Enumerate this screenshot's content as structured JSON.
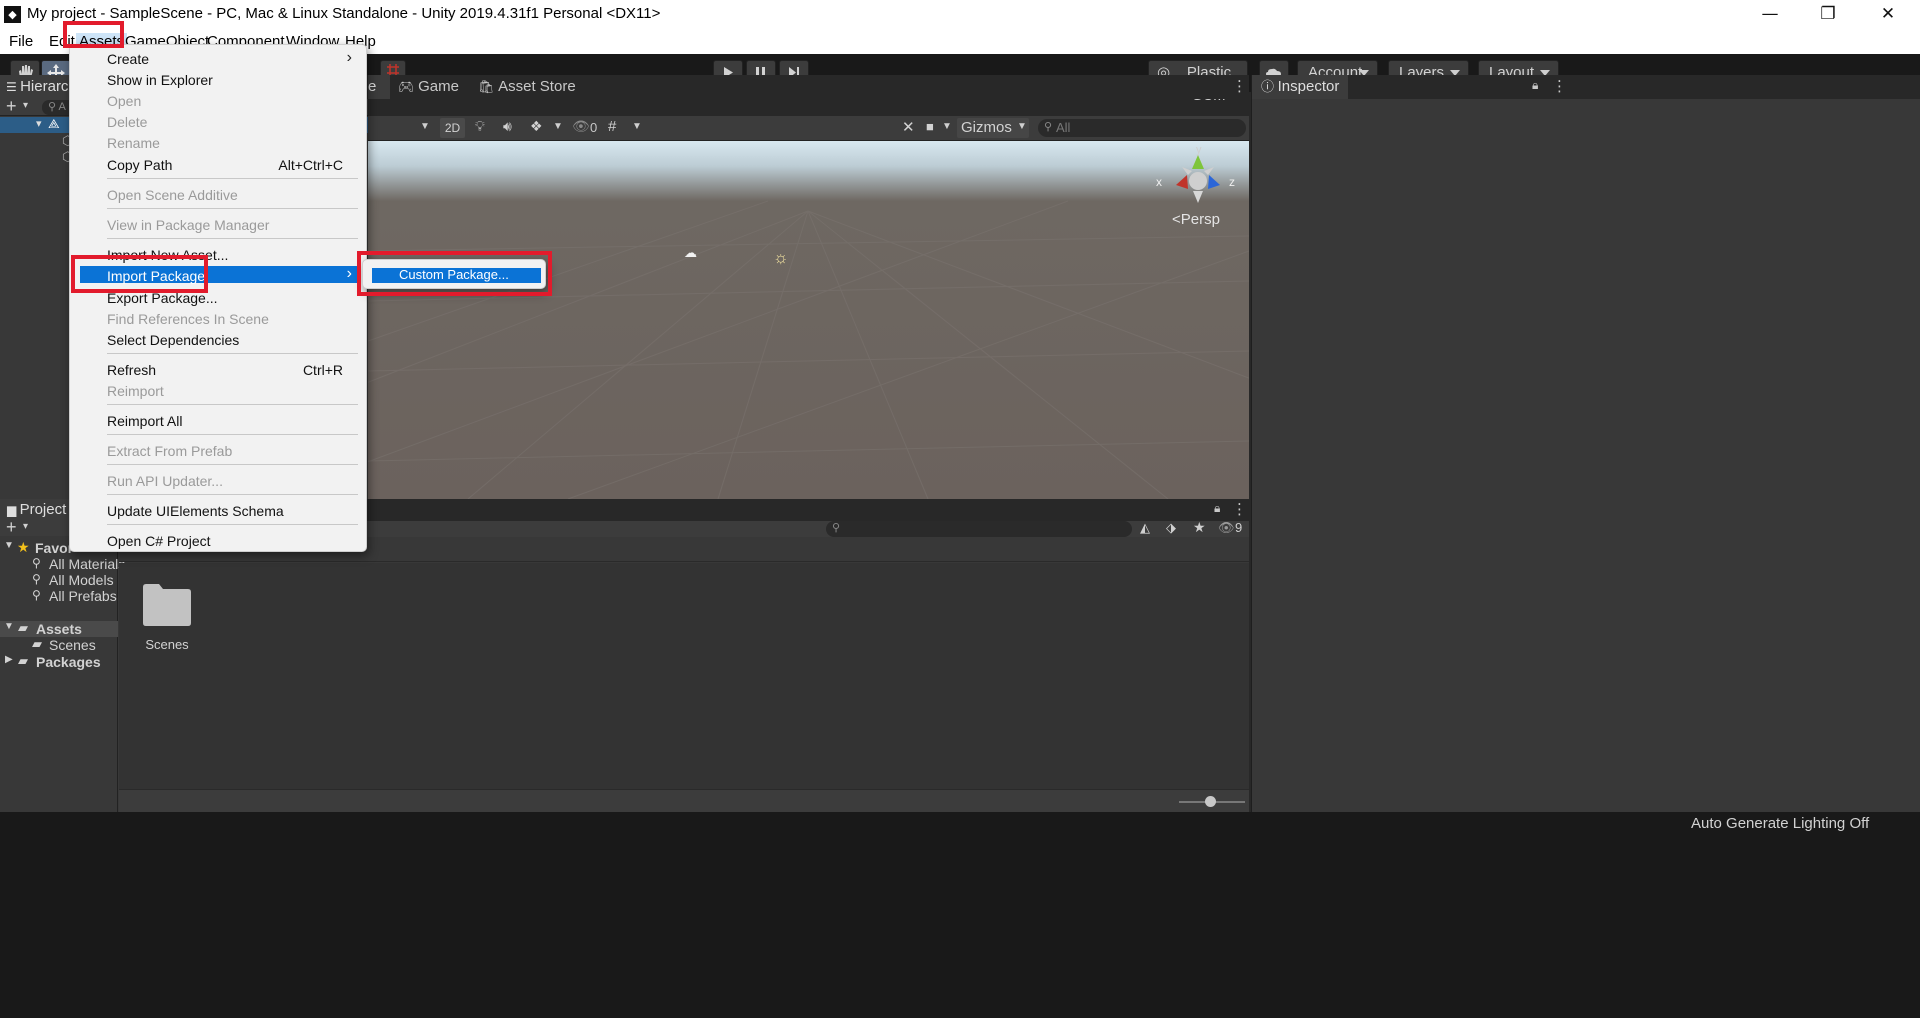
{
  "window": {
    "title": "My project - SampleScene - PC, Mac & Linux Standalone - Unity 2019.4.31f1 Personal <DX11>",
    "minimize_glyph": "—",
    "restore_glyph": "❐",
    "close_glyph": "✕"
  },
  "menubar": {
    "items": [
      "File",
      "Edit",
      "Assets",
      "GameObject",
      "Component",
      "Window",
      "Help"
    ]
  },
  "toolbar": {
    "plastic_scm": "Plastic SCM",
    "account": "Account",
    "layers": "Layers",
    "layout": "Layout"
  },
  "hierarchy": {
    "tab_label": "Hierarch",
    "search_glyph": "A"
  },
  "scene_tabs": {
    "scene_partial": "e",
    "game": "Game",
    "asset_store": "Asset Store"
  },
  "scene_toolbar": {
    "mode_2d": "2D",
    "hidden_count": "0",
    "gizmos": "Gizmos",
    "search_placeholder": "All"
  },
  "scene_gizmo": {
    "x": "x",
    "y": "y",
    "z": "z",
    "persp": "Persp"
  },
  "inspector": {
    "tab_label": "Inspector"
  },
  "project": {
    "tab_label": "Project",
    "hidden_count": "9",
    "favorites_label": "Favor",
    "favorites": [
      "All Materials",
      "All Models",
      "All Prefabs"
    ],
    "assets_label": "Assets",
    "assets_children": [
      "Scenes"
    ],
    "packages_label": "Packages",
    "folder_name": "Scenes"
  },
  "status": {
    "lighting": "Auto Generate Lighting Off"
  },
  "assets_menu": {
    "items": [
      {
        "label": "Create",
        "enabled": true
      },
      {
        "label": "Show in Explorer",
        "enabled": true
      },
      {
        "label": "Open",
        "enabled": false
      },
      {
        "label": "Delete",
        "enabled": false
      },
      {
        "label": "Rename",
        "enabled": false
      },
      {
        "label": "Copy Path",
        "enabled": true,
        "shortcut": "Alt+Ctrl+C"
      },
      {
        "label": "Open Scene Additive",
        "enabled": false
      },
      {
        "label": "View in Package Manager",
        "enabled": false
      },
      {
        "label": "Import New Asset...",
        "enabled": true
      },
      {
        "label": "Import Package",
        "enabled": true,
        "highlighted": true
      },
      {
        "label": "Export Package...",
        "enabled": true
      },
      {
        "label": "Find References In Scene",
        "enabled": false
      },
      {
        "label": "Select Dependencies",
        "enabled": true
      },
      {
        "label": "Refresh",
        "enabled": true,
        "shortcut": "Ctrl+R"
      },
      {
        "label": "Reimport",
        "enabled": false
      },
      {
        "label": "Reimport All",
        "enabled": true
      },
      {
        "label": "Extract From Prefab",
        "enabled": false
      },
      {
        "label": "Run API Updater...",
        "enabled": false
      },
      {
        "label": "Update UIElements Schema",
        "enabled": true
      },
      {
        "label": "Open C# Project",
        "enabled": true
      }
    ],
    "submenu_arrow": "›"
  },
  "import_package_submenu": {
    "items": [
      "Custom Package..."
    ]
  },
  "colors": {
    "highlight": "#0b73d6",
    "annotation": "#e21b2c",
    "x_axis": "#c0342b",
    "y_axis": "#7ec53a",
    "z_axis": "#2b66d8"
  }
}
